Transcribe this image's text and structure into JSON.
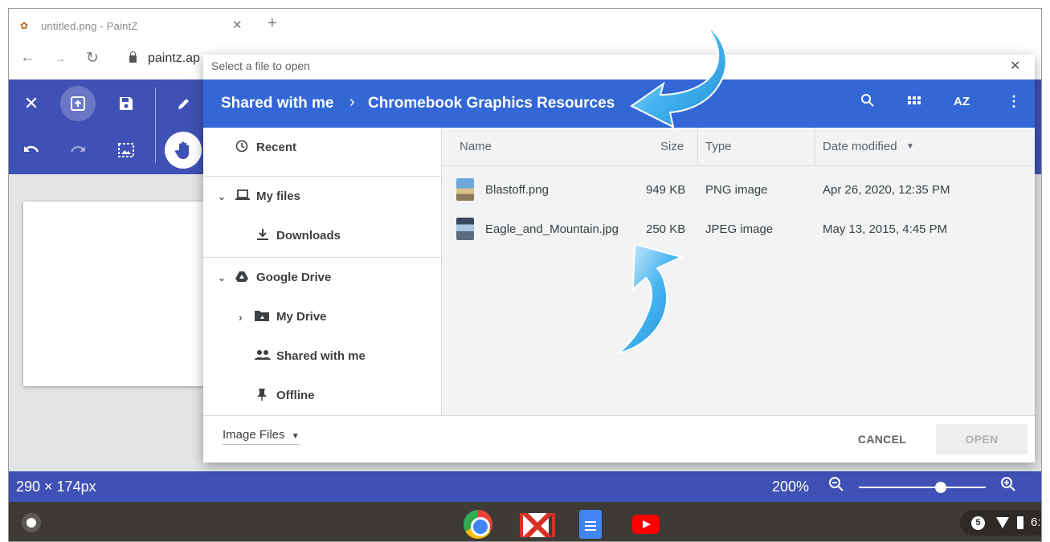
{
  "browser": {
    "tab_title": "untitled.png - PaintZ",
    "url": "paintz.ap"
  },
  "toolbar": {
    "tools": [
      "close-icon",
      "open-icon",
      "save-icon",
      "pencil-icon",
      "undo-icon",
      "redo-icon",
      "crop-icon",
      "hand-icon"
    ]
  },
  "status": {
    "dimensions": "290 × 174px",
    "zoom": "200%",
    "zoom_fraction": 0.62
  },
  "dialog": {
    "title": "Select a file to open",
    "breadcrumb": [
      "Shared with me",
      "Chromebook Graphics Resources"
    ],
    "header_icons": [
      "search-icon",
      "grid-view-icon",
      "sort-az-icon",
      "more-vert-icon"
    ],
    "nav": {
      "recent": "Recent",
      "my_files": "My files",
      "downloads": "Downloads",
      "google_drive": "Google Drive",
      "my_drive": "My Drive",
      "shared_with_me": "Shared with me",
      "offline": "Offline"
    },
    "columns": {
      "name": "Name",
      "size": "Size",
      "type": "Type",
      "date_modified": "Date modified"
    },
    "files": [
      {
        "name": "Blastoff.png",
        "size": "949 KB",
        "type": "PNG image",
        "date": "Apr 26, 2020, 12:35 PM"
      },
      {
        "name": "Eagle_and_Mountain.jpg",
        "size": "250 KB",
        "type": "JPEG image",
        "date": "May 13, 2015, 4:45 PM"
      }
    ],
    "filter": "Image Files",
    "cancel_label": "CANCEL",
    "open_label": "OPEN"
  },
  "shelf": {
    "apps": [
      "chrome-icon",
      "gmail-icon",
      "docs-icon",
      "youtube-icon"
    ],
    "notification_count": "5",
    "clock": "6:"
  },
  "colors": {
    "app_toolbar": "#3f51b5",
    "dialog_header": "#3367d6",
    "annotation_arrow": "#29a3e8"
  }
}
